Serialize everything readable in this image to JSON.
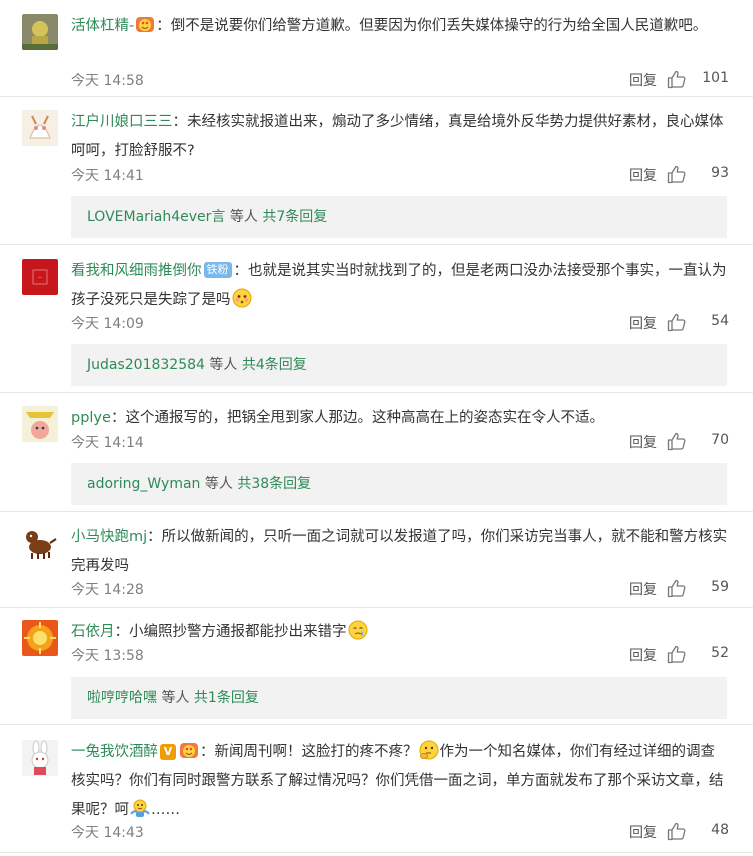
{
  "comments": [
    {
      "user": "活体杠精-",
      "text": "倒不是说要你们给警方道歉。但要因为你们丢失媒体操守的行为给全国人民道歉吧。",
      "time": "今天 14:58",
      "reply_label": "回复",
      "likes": "101"
    },
    {
      "user": "江户川娘口三三",
      "text": "未经核实就报道出来，煽动了多少情绪，真是给境外反华势力提供好素材，良心媒体呵呵，打脸舒服不?",
      "time": "今天 14:41",
      "reply_label": "回复",
      "likes": "93",
      "sub_reply": {
        "user": "LOVEMariah4ever言",
        "mid": " 等人 ",
        "count": "共7条回复"
      }
    },
    {
      "user": "看我和风细雨推倒你",
      "badge": "铁粉",
      "text": "也就是说其实当时就找到了的，但是老两口没办法接受那个事实，一直认为孩子没死只是失踪了是吗",
      "time": "今天 14:09",
      "reply_label": "回复",
      "likes": "54",
      "sub_reply": {
        "user": "Judas201832584",
        "mid": " 等人 ",
        "count": "共4条回复"
      }
    },
    {
      "user": "pplye",
      "text": "这个通报写的，把锅全甩到家人那边。这种高高在上的姿态实在令人不适。",
      "time": "今天 14:14",
      "reply_label": "回复",
      "likes": "70",
      "sub_reply": {
        "user": "adoring_Wyman",
        "mid": " 等人 ",
        "count": "共38条回复"
      }
    },
    {
      "user": "小马快跑mj",
      "text": "所以做新闻的，只听一面之词就可以发报道了吗，你们采访完当事人，就不能和警方核实完再发吗",
      "time": "今天 14:28",
      "reply_label": "回复",
      "likes": "59"
    },
    {
      "user": "石依月",
      "text": "小编照抄警方通报都能抄出来错字",
      "time": "今天 13:58",
      "reply_label": "回复",
      "likes": "52",
      "sub_reply": {
        "user": "啦哼哼哈嘿",
        "mid": " 等人 ",
        "count": "共1条回复"
      }
    },
    {
      "user": "一兔我饮酒醉",
      "badge_v": "V",
      "text_a": "新闻周刊啊！这脸打的疼不疼？",
      "text_b": "作为一个知名媒体，你们有经过详细的调查核实吗？你们有同时跟警方联系了解过情况吗？你们凭借一面之词，单方面就发布了那个采访文章，结果呢？呵",
      "text_c": "……",
      "time": "今天 14:43",
      "reply_label": "回复",
      "likes": "48"
    }
  ],
  "colors": {
    "username": "#2e8b57",
    "meta": "#808080",
    "reply_bg": "#f2f2f2"
  },
  "icons": [
    "thumbs-up-icon",
    "avatar",
    "emoji-heart-eyes",
    "emoji-flushed",
    "emoji-crying",
    "emoji-thinking",
    "emoji-shrug"
  ]
}
